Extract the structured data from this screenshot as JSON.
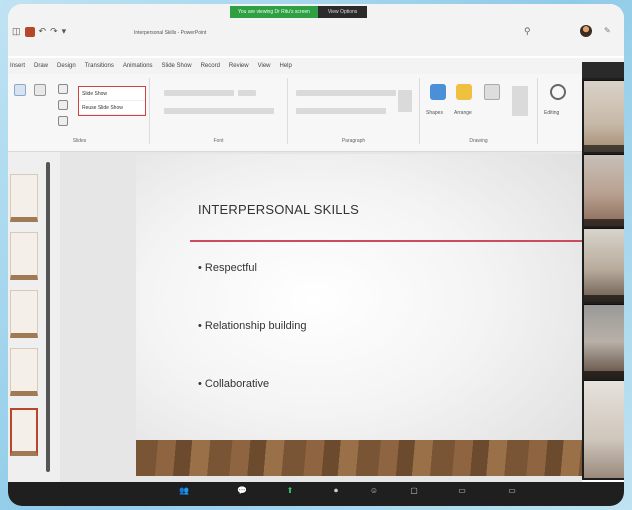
{
  "share_banner": {
    "status": "You are viewing Dr Ritu's screen",
    "options": "View Options"
  },
  "window": {
    "title": "Interpersonal Skills - PowerPoint"
  },
  "icons": {
    "save": "save-icon",
    "undo": "undo-icon",
    "redo": "redo-icon",
    "search": "search-icon",
    "pen": "pen-icon"
  },
  "colors": {
    "accent": "#b7472a",
    "rule": "#c94d5e",
    "share_green": "#2ea043"
  },
  "menu": {
    "tabs": [
      "Insert",
      "Draw",
      "Design",
      "Transitions",
      "Animations",
      "Slide Show",
      "Record",
      "Review",
      "View",
      "Help"
    ]
  },
  "ribbon": {
    "slide_dropdown": [
      "Slide Show",
      "Reuse Slide Show"
    ],
    "groups": [
      "Slides",
      "Font",
      "Paragraph",
      "Drawing"
    ],
    "drawing_buttons": [
      "Shapes",
      "Arrange"
    ],
    "editing": "Editing"
  },
  "slide": {
    "title": "INTERPERSONAL SKILLS",
    "bullets": [
      "Respectful",
      "Relationship building",
      "Collaborative"
    ]
  }
}
